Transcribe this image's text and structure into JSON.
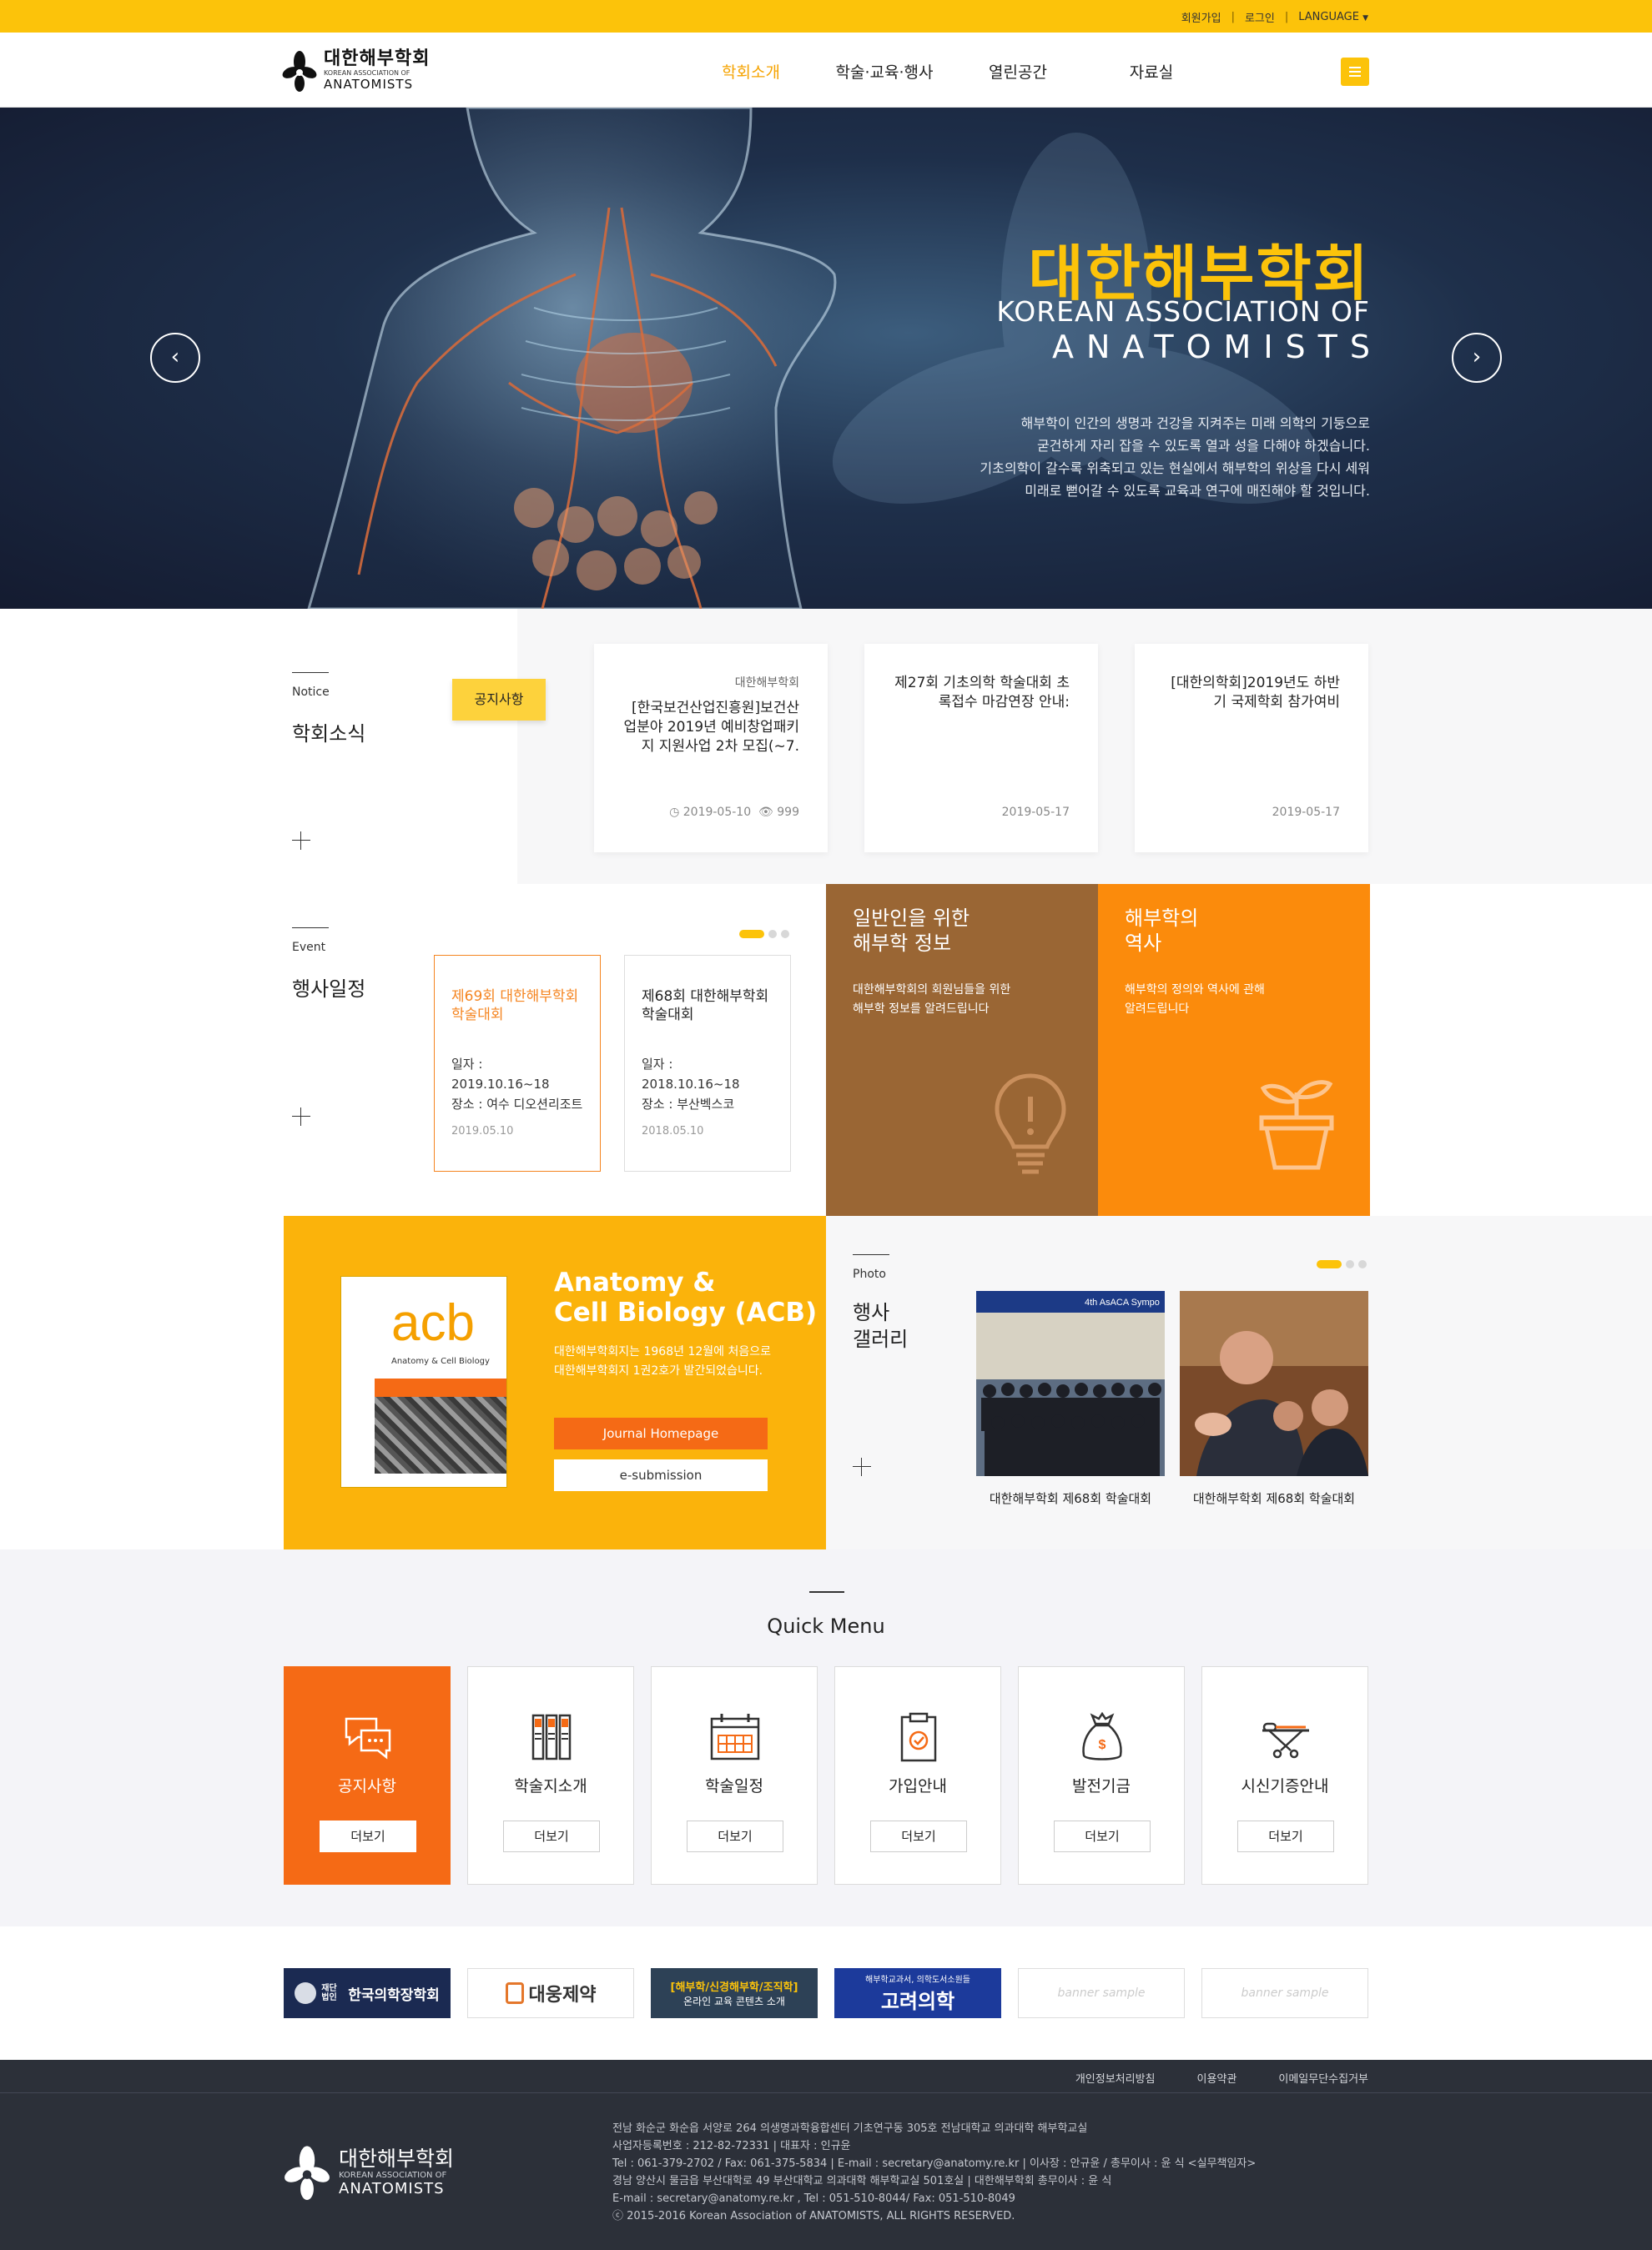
{
  "topbar": {
    "join": "회원가입",
    "login": "로그인",
    "language": "LANGUAGE"
  },
  "header": {
    "logo_ko": "대한해부학회",
    "logo_en1": "KOREAN ASSOCIATION OF",
    "logo_en2": "ANATOMISTS",
    "nav": [
      "학회소개",
      "학술·교육·행사",
      "열린공간",
      "자료실"
    ]
  },
  "hero": {
    "title_ko": "대한해부학회",
    "title_en1": "KOREAN ASSOCIATION OF",
    "title_en2": "ANATOMISTS",
    "desc": [
      "해부학이 인간의 생명과 건강을 지켜주는 미래 의학의 기둥으로",
      "굳건하게 자리 잡을 수 있도록 열과 성을 다해야 하겠습니다.",
      "기초의학이 갈수록 위축되고 있는 현실에서 해부학의 위상을 다시 세워",
      "미래로 뻗어갈 수 있도록 교육과 연구에 매진해야 할 것입니다."
    ],
    "prev": "‹",
    "next": "›"
  },
  "notice": {
    "label": "Notice",
    "title": "학회소식",
    "tag": "공지사항",
    "cards": [
      {
        "category": "대한해부학회",
        "title": "[한국보건산업진흥원]보건산업분야 2019년 예비창업패키지 지원사업 2차 모집(~7.",
        "date": "2019-05-10",
        "views": "999"
      },
      {
        "category": "",
        "title": "제27회 기초의학 학술대회 초록접수 마감연장 안내:",
        "date": "2019-05-17",
        "views": ""
      },
      {
        "category": "",
        "title": "[대한의학회]2019년도 하반기 국제학회 참가여비",
        "date": "2019-05-17",
        "views": ""
      }
    ]
  },
  "event": {
    "label": "Event",
    "title": "행사일정",
    "cards": [
      {
        "title": "제69회 대한해부학회 학술대회",
        "date_line": "일자 : 2019.10.16~18",
        "place_line": "장소 : 여수 디오션리조트",
        "posted": "2019.05.10"
      },
      {
        "title": "제68회 대한해부학회 학술대회",
        "date_line": "일자 : 2018.10.16~18",
        "place_line": "장소 : 부산벡스코",
        "posted": "2018.05.10"
      }
    ]
  },
  "info_boxes": [
    {
      "title": "일반인을 위한\n해부학 정보",
      "sub": "대한해부학회의 회원님들을 위한\n해부학 정보를 알려드립니다",
      "icon": "lightbulb-icon",
      "color": "#9a6634"
    },
    {
      "title": "해부학의\n역사",
      "sub": "해부학의 정의와 역사에 관해\n알려드립니다",
      "icon": "plant-pot-icon",
      "color": "#fb8b0c"
    }
  ],
  "acb": {
    "title1": "Anatomy &",
    "title2": "Cell Biology (ACB)",
    "desc1": "대한해부학회지는 1968년 12월에 처음으로",
    "desc2": "대한해부학회지 1권2호가 발간되었습니다.",
    "journal_btn": "Journal Homepage",
    "submission_btn": "e-submission",
    "cover_logo": "acb",
    "cover_sub": "Anatomy & Cell Biology"
  },
  "photo": {
    "label": "Photo",
    "title": "행사\n갤러리",
    "items": [
      {
        "caption": "대한해부학회 제68회 학술대회",
        "banner": "4th AsACA Sympo"
      },
      {
        "caption": "대한해부학회 제68회 학술대회"
      }
    ]
  },
  "quick": {
    "title": "Quick Menu",
    "more": "더보기",
    "items": [
      {
        "label": "공지사항",
        "icon": "speech-bubbles-icon"
      },
      {
        "label": "학술지소개",
        "icon": "journals-icon"
      },
      {
        "label": "학술일정",
        "icon": "calendar-icon"
      },
      {
        "label": "가입안내",
        "icon": "clipboard-check-icon"
      },
      {
        "label": "발전기금",
        "icon": "money-bag-icon"
      },
      {
        "label": "시신기증안내",
        "icon": "stretcher-icon"
      }
    ]
  },
  "banners": [
    {
      "text": "한국의학장학회",
      "pre": "재단법인",
      "bg": "#1b2a52"
    },
    {
      "text": "대웅제약",
      "bg": "#ffffff",
      "fg": "#e4772b"
    },
    {
      "text": "[해부학/신경해부학/조직학]",
      "sub": "온라인 교육 콘텐츠 소개",
      "bg": "#2d4156"
    },
    {
      "text": "고려의학",
      "pre": "해부학교과서, 의학도서소원들",
      "bg": "#1c3a9b"
    },
    {
      "text": "banner sample"
    },
    {
      "text": "banner sample"
    }
  ],
  "footer": {
    "links": [
      "개인정보처리방침",
      "이용약관",
      "이메일무단수집거부"
    ],
    "logo_ko": "대한해부학회",
    "logo_en1": "KOREAN ASSOCIATION OF",
    "logo_en2": "ANATOMISTS",
    "lines": [
      "전남 화순군 화순읍 서양로 264 의생명과학융합센터 기초연구동 305호 전남대학교 의과대학 해부학교실",
      "사업자등록번호 : 212-82-72331 | 대표자 : 인규윤",
      "Tel : 061-379-2702 / Fax: 061-375-5834 | E-mail : secretary@anatomy.re.kr | 이사장 : 안규윤 / 총무이사 : 윤 식 <실무책임자>",
      "경남 양산시 물금읍 부산대학로 49 부산대학교 의과대학 해부학교실 501호실 | 대한해부학회 총무이사 : 윤 식",
      "E-mail : secretary@anatomy.re.kr , Tel : 051-510-8044/ Fax: 051-510-8049",
      "ⓒ 2015-2016 Korean Association of ANATOMISTS, ALL RIGHTS RESERVED."
    ]
  },
  "colors": {
    "accent": "#fcc30a",
    "orange": "#f56a15",
    "brown": "#9a6634",
    "dark": "#2c3039"
  }
}
